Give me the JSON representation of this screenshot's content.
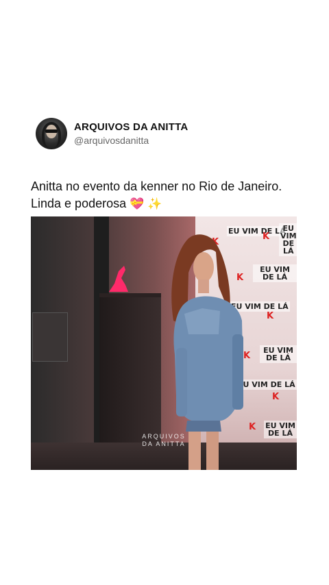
{
  "post": {
    "author": {
      "display_name": "ARQUIVOS DA ANITTA",
      "handle": "@arquivosdanitta"
    },
    "caption_line1": "Anitta no evento da kenner no Rio de Janeiro.",
    "caption_line2": "Linda e poderosa",
    "emojis": [
      "heart-with-ribbon",
      "sparkles"
    ]
  },
  "media": {
    "banner_text": "EU VIM DE LÁ",
    "watermark_line1": "ARQUIVOS",
    "watermark_line2": "DA ANITTA"
  }
}
